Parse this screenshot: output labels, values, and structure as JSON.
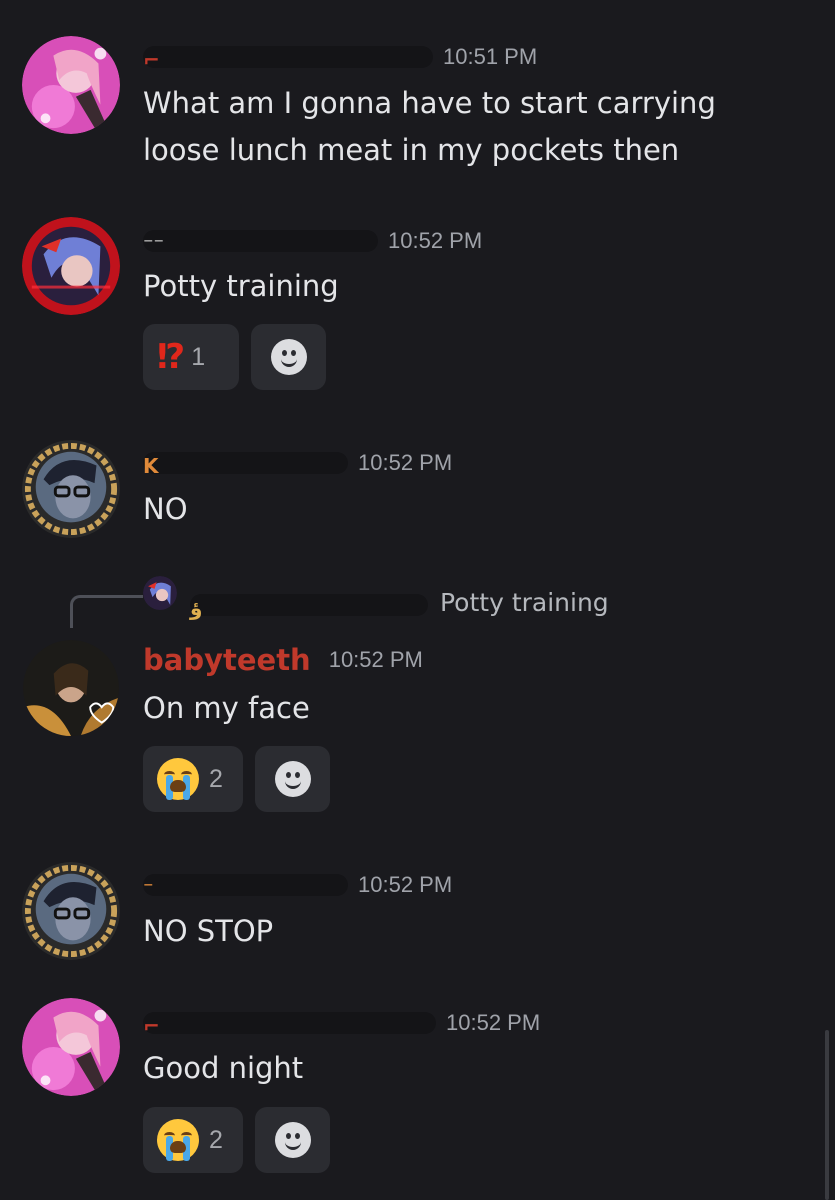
{
  "messages": [
    {
      "time": "10:51 PM",
      "text": "What am I gonna have to start carrying\nloose lunch meat in my pockets then"
    },
    {
      "time": "10:52 PM",
      "text": "Potty training",
      "reactions": [
        {
          "emoji": "⁉",
          "count": "1"
        }
      ]
    },
    {
      "time": "10:52 PM",
      "text": "NO"
    },
    {
      "reply_preview": "Potty training",
      "username": "babyteeth",
      "time": "10:52 PM",
      "text": "On my face",
      "reactions": [
        {
          "emoji": "sob",
          "count": "2"
        }
      ]
    },
    {
      "time": "10:52 PM",
      "text": "NO STOP"
    },
    {
      "time": "10:52 PM",
      "text": "Good night",
      "reactions": [
        {
          "emoji": "sob",
          "count": "2"
        }
      ]
    }
  ],
  "colors": {
    "background": "#1a1a1e",
    "username_babyteeth": "#c0392b",
    "reaction_bg": "#2b2c31",
    "timestamp": "#a0a3aa"
  },
  "icons": {
    "add_reaction": "smiley-face-icon",
    "interrobang": "interrobang-emoji",
    "sob": "loudly-crying-face-emoji"
  }
}
